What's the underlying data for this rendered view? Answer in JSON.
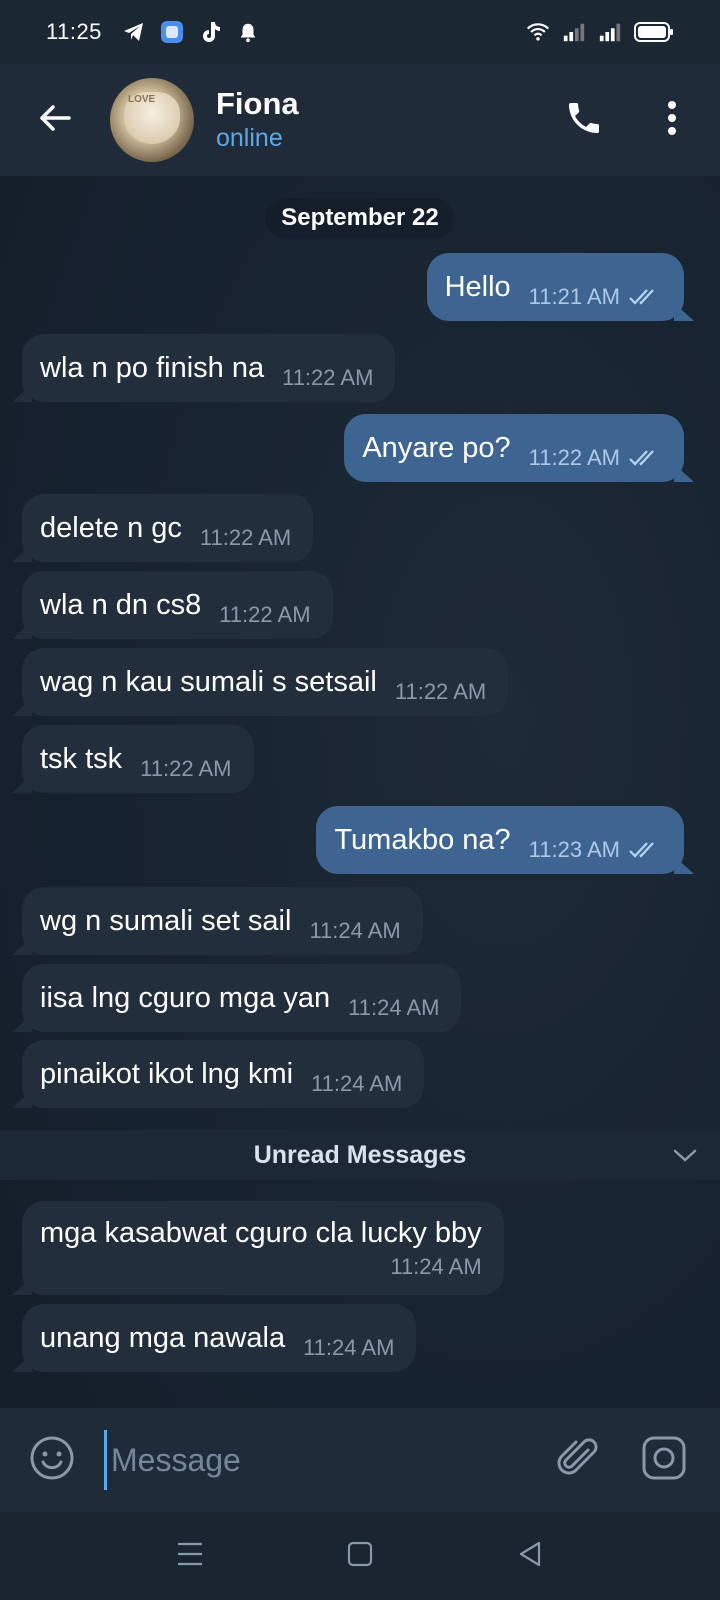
{
  "status_bar": {
    "time": "11:25",
    "left_icons": [
      "telegram-icon",
      "app-icon",
      "tiktok-icon",
      "notification-icon"
    ],
    "right_icons": [
      "wifi-icon",
      "signal-icon",
      "signal-icon",
      "battery-icon"
    ]
  },
  "header": {
    "name": "Fiona",
    "status": "online",
    "avatar_text": "LOVE"
  },
  "chat": {
    "date_label": "September 22",
    "messages": [
      {
        "dir": "out",
        "text": "Hello",
        "time": "11:21 AM",
        "read": true
      },
      {
        "dir": "in",
        "text": "wla n po finish na",
        "time": "11:22 AM"
      },
      {
        "dir": "out",
        "text": "Anyare po?",
        "time": "11:22 AM",
        "read": true
      },
      {
        "dir": "in",
        "text": "delete n gc",
        "time": "11:22 AM"
      },
      {
        "dir": "in",
        "text": "wla n dn cs8",
        "time": "11:22 AM"
      },
      {
        "dir": "in",
        "text": "wag n kau sumali s setsail",
        "time": "11:22 AM"
      },
      {
        "dir": "in",
        "text": "tsk tsk",
        "time": "11:22 AM"
      },
      {
        "dir": "out",
        "text": "Tumakbo na?",
        "time": "11:23 AM",
        "read": true
      },
      {
        "dir": "in",
        "text": "wg n sumali set sail",
        "time": "11:24 AM"
      },
      {
        "dir": "in",
        "text": "iisa lng cguro mga yan",
        "time": "11:24 AM"
      },
      {
        "dir": "in",
        "text": "pinaikot ikot lng kmi",
        "time": "11:24 AM"
      },
      {
        "dir": "in",
        "text": "mga kasabwat cguro cla lucky bby",
        "time": "11:24 AM"
      },
      {
        "dir": "in",
        "text": "unang mga nawala",
        "time": "11:24 AM"
      }
    ],
    "unread_label": "Unread Messages"
  },
  "input": {
    "placeholder": "Message",
    "value": ""
  },
  "colors": {
    "accent": "#5fa8e8",
    "outgoing_bubble": "#3e6591",
    "incoming_bubble": "#222e3c",
    "background": "#182230"
  }
}
